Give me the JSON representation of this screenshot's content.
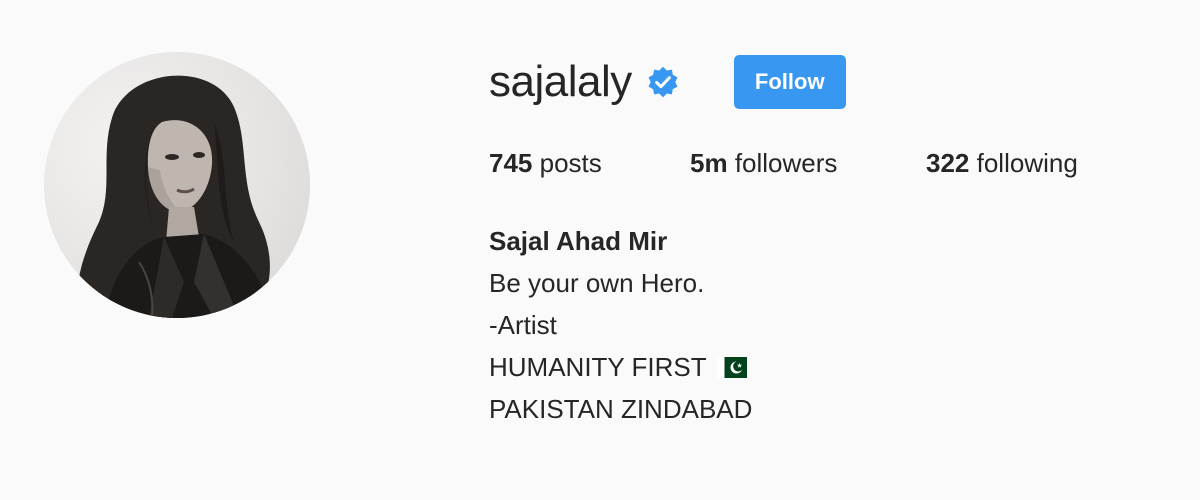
{
  "profile": {
    "username": "sajalaly",
    "follow_label": "Follow",
    "verified": true,
    "avatar_icon": "profile-photo",
    "stats": {
      "posts_count": "745",
      "posts_label": "posts",
      "followers_count": "5m",
      "followers_label": "followers",
      "following_count": "322",
      "following_label": "following"
    },
    "bio": {
      "full_name": "Sajal Ahad Mir",
      "lines": [
        "Be your own Hero.",
        "-Artist",
        "HUMANITY FIRST",
        "PAKISTAN ZINDABAD"
      ],
      "flag_icon": "pakistan-flag-icon"
    }
  },
  "colors": {
    "background": "#fafafa",
    "text": "#262626",
    "follow_button": "#3897f0",
    "verified_badge": "#3897f0"
  }
}
